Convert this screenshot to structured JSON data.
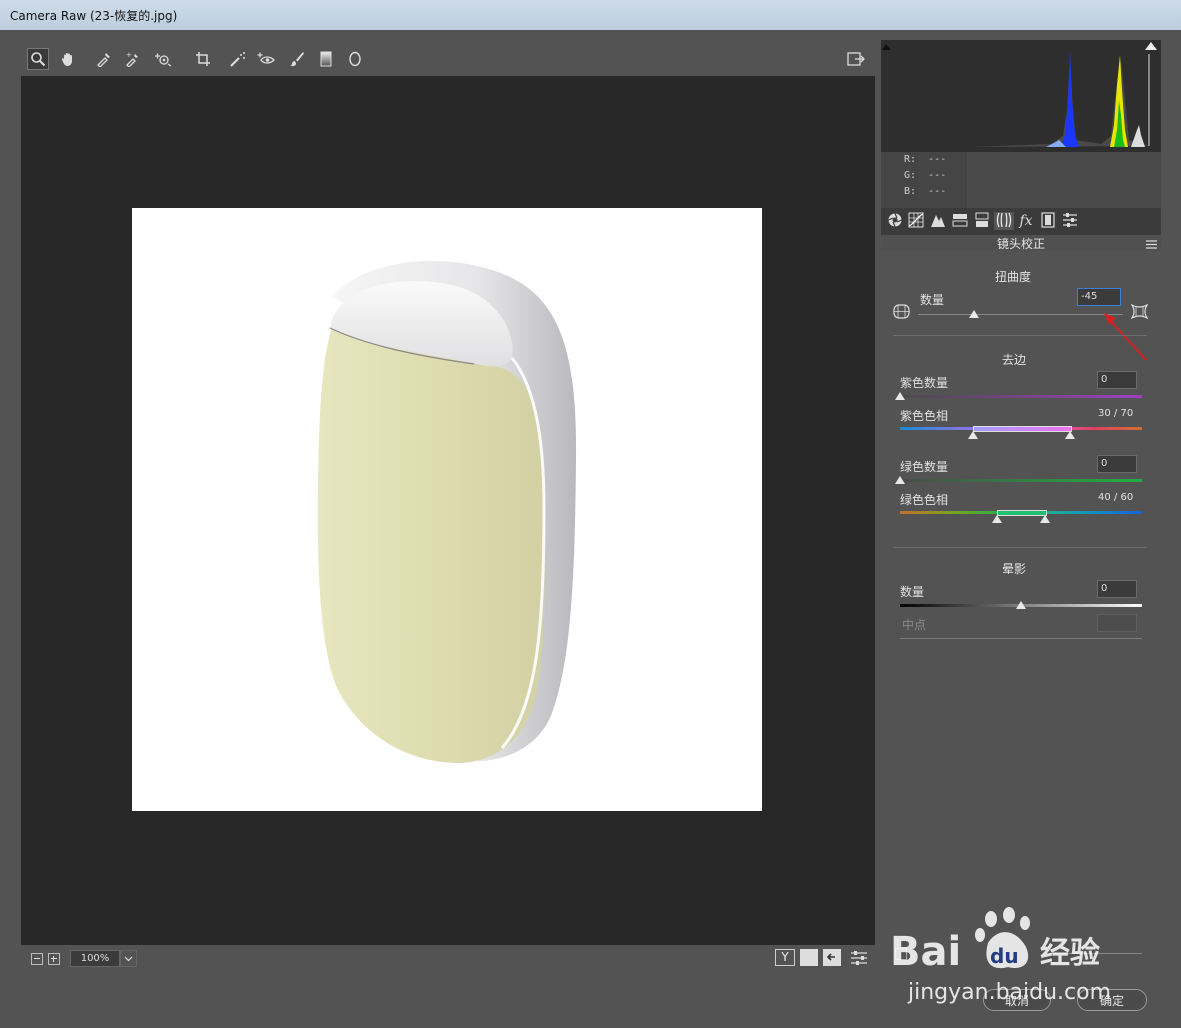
{
  "window": {
    "title": "Camera Raw (23-恢复的.jpg)"
  },
  "toolbar": {
    "tools": [
      "zoom-tool",
      "hand-tool",
      "white-balance-tool",
      "color-sampler-tool",
      "targeted-adjustment-tool",
      "crop-tool",
      "straighten-tool",
      "spot-removal-tool",
      "red-eye-tool",
      "adjustment-brush",
      "graduated-filter",
      "radial-filter"
    ],
    "open_preferences_icon": "preferences-icon"
  },
  "histogram": {
    "readout": {
      "r_label": "R:",
      "r_value": "---",
      "g_label": "G:",
      "g_value": "---",
      "b_label": "B:",
      "b_value": "---"
    }
  },
  "panel_tabs": [
    "basic",
    "tone-curve",
    "detail",
    "hsl",
    "split-toning",
    "lens-corrections",
    "effects",
    "camera-calibration",
    "presets"
  ],
  "lens_panel": {
    "title": "镜头校正",
    "distortion": {
      "heading": "扭曲度",
      "amount_label": "数量",
      "amount_value": "-45",
      "amount_level": -45
    },
    "defringe": {
      "heading": "去边",
      "purple_amount_label": "紫色数量",
      "purple_amount_value": "0",
      "purple_hue_label": "紫色色相",
      "purple_hue_value": "30 / 70",
      "green_amount_label": "绿色数量",
      "green_amount_value": "0",
      "green_hue_label": "绿色色相",
      "green_hue_value": "40 / 60"
    },
    "vignetting": {
      "heading": "晕影",
      "amount_label": "数量",
      "amount_value": "0",
      "midpoint_label": "中点",
      "midpoint_value": ""
    }
  },
  "bottom": {
    "zoom_level": "100%",
    "buttons": {
      "cancel": "取消",
      "ok": "确定"
    },
    "watermark": {
      "brand": "Bai",
      "brand2": "du",
      "cn": "经验",
      "url": "jingyan.baidu.com"
    }
  },
  "colors": {
    "window_bg": "#535353",
    "canvas_bg": "#282828",
    "accent": "#3b80d6",
    "annotation_arrow": "#d42020"
  }
}
